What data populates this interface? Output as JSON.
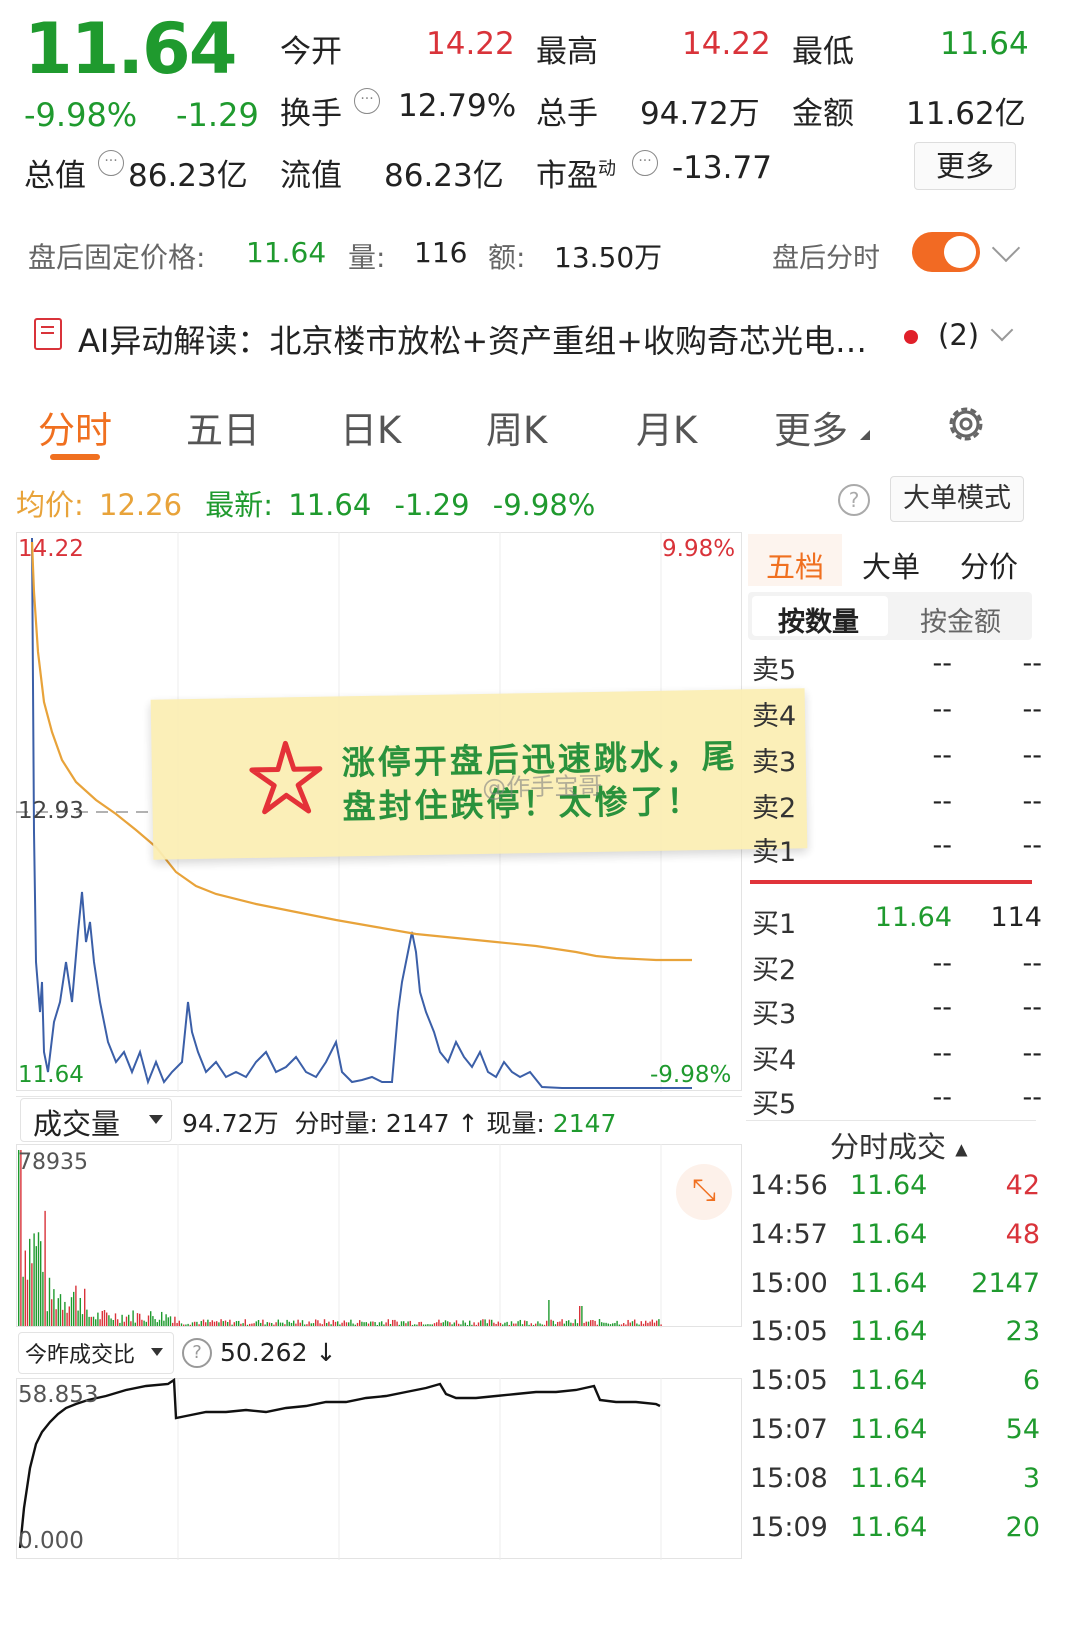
{
  "header": {
    "price": "11.64",
    "change_pct": "-9.98%",
    "change": "-1.29",
    "open_label": "今开",
    "open": "14.22",
    "high_label": "最高",
    "high": "14.22",
    "low_label": "最低",
    "low": "11.64",
    "turnover_label": "换手",
    "turnover": "12.79%",
    "volume_label": "总手",
    "volume": "94.72万",
    "amount_label": "金额",
    "amount": "11.62亿",
    "mktcap_label": "总值",
    "mktcap": "86.23亿",
    "float_label": "流值",
    "float": "86.23亿",
    "pe_label": "市盈",
    "pe_sup": "动",
    "pe": "-13.77",
    "more_button": "更多"
  },
  "after_hours": {
    "price_label": "盘后固定价格:",
    "price": "11.64",
    "vol_label": "量:",
    "vol": "116",
    "amt_label": "额:",
    "amt": "13.50万",
    "toggle_label": "盘后分时"
  },
  "ai_banner": {
    "text": "AI异动解读：北京楼市放松+资产重组+收购奇芯光电…",
    "count": "(2)"
  },
  "tabs": [
    "分时",
    "五日",
    "日K",
    "周K",
    "月K",
    "更多"
  ],
  "summary": {
    "avg_label": "均价:",
    "avg": "12.26",
    "latest_label": "最新:",
    "latest": "11.64",
    "chg": "-1.29",
    "chg_pct": "-9.98%",
    "big_order_mode": "大单模式"
  },
  "chart_labels": {
    "top_price": "14.22",
    "top_pct": "9.98%",
    "mid_price": "12.93",
    "bottom_price": "11.64",
    "bottom_pct": "-9.98%"
  },
  "annotation": {
    "line1": "涨停开盘后迅速跳水，尾",
    "line2": "盘封住跌停！太惨了！",
    "watermark": "@作手宝哥"
  },
  "volume_panel": {
    "selector": "成交量",
    "total": "94.72万",
    "minute_label": "分时量:",
    "minute_value": "2147",
    "current_label": "现量:",
    "current_value": "2147",
    "max": "78935"
  },
  "ratio_panel": {
    "selector": "今昨成交比",
    "value": "50.262",
    "max": "58.853",
    "min": "0.000"
  },
  "order_book": {
    "tabs": [
      "五档",
      "大单",
      "分价"
    ],
    "subtabs": [
      "按数量",
      "按金额"
    ],
    "asks": [
      {
        "label": "卖5",
        "price": "--",
        "vol": "--"
      },
      {
        "label": "卖4",
        "price": "--",
        "vol": "--"
      },
      {
        "label": "卖3",
        "price": "--",
        "vol": "--"
      },
      {
        "label": "卖2",
        "price": "--",
        "vol": "--"
      },
      {
        "label": "卖1",
        "price": "--",
        "vol": "--"
      }
    ],
    "bids": [
      {
        "label": "买1",
        "price": "11.64",
        "vol": "114"
      },
      {
        "label": "买2",
        "price": "--",
        "vol": "--"
      },
      {
        "label": "买3",
        "price": "--",
        "vol": "--"
      },
      {
        "label": "买4",
        "price": "--",
        "vol": "--"
      },
      {
        "label": "买5",
        "price": "--",
        "vol": "--"
      }
    ]
  },
  "ticks": {
    "title": "分时成交",
    "rows": [
      {
        "time": "14:56",
        "price": "11.64",
        "vol": "42",
        "color": "#d9333a"
      },
      {
        "time": "14:57",
        "price": "11.64",
        "vol": "48",
        "color": "#d9333a"
      },
      {
        "time": "15:00",
        "price": "11.64",
        "vol": "2147",
        "color": "#1f9a2e"
      },
      {
        "time": "15:05",
        "price": "11.64",
        "vol": "23",
        "color": "#1f9a2e"
      },
      {
        "time": "15:05",
        "price": "11.64",
        "vol": "6",
        "color": "#1f9a2e"
      },
      {
        "time": "15:07",
        "price": "11.64",
        "vol": "54",
        "color": "#1f9a2e"
      },
      {
        "time": "15:08",
        "price": "11.64",
        "vol": "3",
        "color": "#1f9a2e"
      },
      {
        "time": "15:09",
        "price": "11.64",
        "vol": "20",
        "color": "#1f9a2e"
      }
    ]
  },
  "colors": {
    "up": "#d9333a",
    "down": "#1f9a2e",
    "accent": "#f07020",
    "price_line": "#3b5fa8",
    "avg_line": "#e8a33a"
  }
}
